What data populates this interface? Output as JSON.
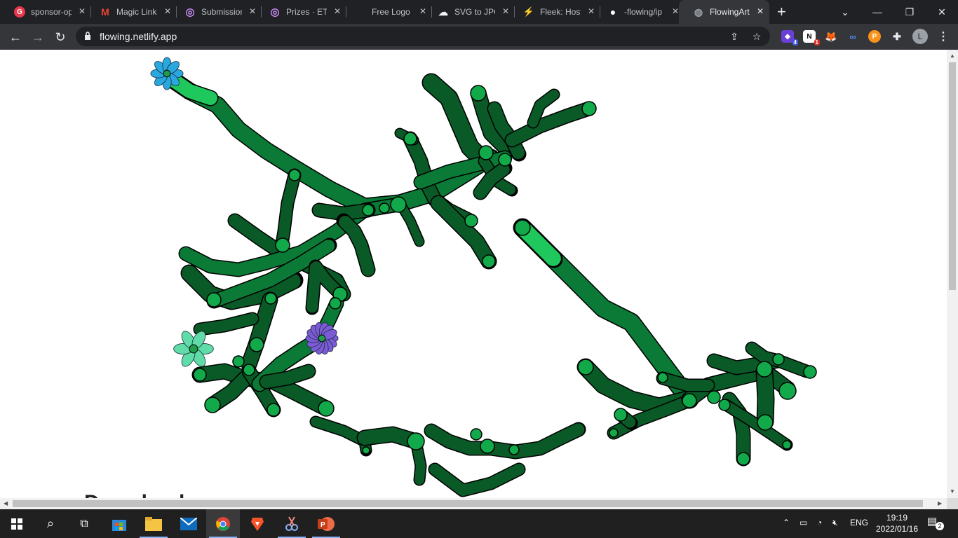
{
  "browser": {
    "tabs": [
      {
        "title": "sponsor-op",
        "favicon": "gitcoin-icon",
        "color": "#e8374d",
        "glyph": "G"
      },
      {
        "title": "Magic Link",
        "favicon": "gmail-icon",
        "color": "#ea4335",
        "glyph": "M"
      },
      {
        "title": "Submission",
        "favicon": "ethglobal-icon",
        "color": "#8c6cf2",
        "glyph": "◎"
      },
      {
        "title": "Prizes · ETH",
        "favicon": "ethglobal-icon",
        "color": "#8c6cf2",
        "glyph": "◎"
      },
      {
        "title": "Free Logo",
        "favicon": "blank-icon",
        "color": "#202124",
        "glyph": ""
      },
      {
        "title": "SVG to JPG",
        "favicon": "cloud-icon",
        "color": "#f1f3f4",
        "glyph": "☁"
      },
      {
        "title": "Fleek: Host",
        "favicon": "fleek-icon",
        "color": "#2ecc71",
        "glyph": "⚡"
      },
      {
        "title": "-flowing/ip",
        "favicon": "github-icon",
        "color": "#ffffff",
        "glyph": "●"
      },
      {
        "title": "FlowingArt",
        "favicon": "globe-icon",
        "color": "#9aa0a6",
        "glyph": "◍"
      }
    ],
    "new_tab": "+",
    "url": "flowing.netlify.app",
    "extensions": [
      {
        "name": "wallet-extension-icon",
        "badge": "4",
        "color": "#6a3fd8",
        "badge_color": "#3b5bdb"
      },
      {
        "name": "notion-extension-icon",
        "badge": "1",
        "color": "#ffffff",
        "badge_color": "#d93025"
      },
      {
        "name": "metamask-icon",
        "badge": "",
        "color": "#e2761b",
        "badge_color": ""
      },
      {
        "name": "loop-extension-icon",
        "badge": "",
        "color": "#1a73e8",
        "badge_color": ""
      },
      {
        "name": "bitcoin-extension-icon",
        "badge": "",
        "color": "#f7931a",
        "badge_color": ""
      }
    ],
    "profile_initial": "L"
  },
  "page": {
    "partial_heading": "Download"
  },
  "artwork": {
    "flowers": [
      {
        "name": "blue-flower-icon",
        "color": "#29a8e0"
      },
      {
        "name": "purple-flower-icon",
        "color": "#7b5cd6"
      },
      {
        "name": "mint-flower-icon",
        "color": "#5fdca8"
      }
    ],
    "stem_color": "#0b7a36",
    "bud_color": "#11a94a",
    "outline_color": "#000000"
  },
  "taskbar": {
    "apps": [
      "start-icon",
      "search-icon",
      "task-view-icon",
      "store-icon",
      "file-explorer-icon",
      "mail-icon",
      "chrome-icon",
      "brave-icon",
      "snip-icon",
      "powerpoint-icon"
    ],
    "language": "ENG",
    "time": "19:19",
    "date": "2022/01/16",
    "notifications": "2"
  }
}
